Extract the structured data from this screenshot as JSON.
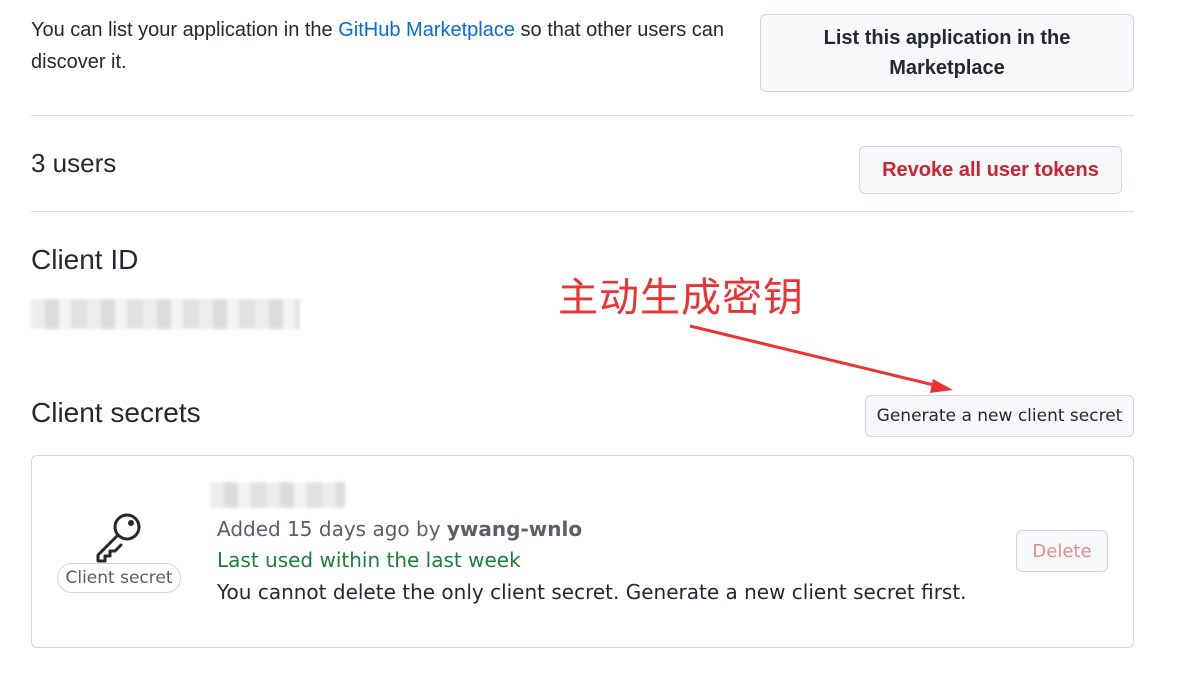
{
  "marketplace": {
    "text_before": "You can list your application in the ",
    "link_text": "GitHub Marketplace",
    "text_after": " so that other users can discover it.",
    "button_label": "List this application in the Marketplace"
  },
  "users": {
    "title": "3 users",
    "revoke_button_label": "Revoke all user tokens"
  },
  "client_id": {
    "title": "Client ID"
  },
  "annotation": {
    "text": "主动生成密钥",
    "color": "#ec3232"
  },
  "client_secrets": {
    "title": "Client secrets",
    "generate_button_label": "Generate a new client secret",
    "secret": {
      "icon": "key-icon",
      "badge_label": "Client secret",
      "added_prefix": "Added 15 days ago by ",
      "added_by": "ywang-wnlo",
      "last_used": "Last used within the last week",
      "warning": "You cannot delete the only client secret. Generate a new client secret first.",
      "delete_button_label": "Delete"
    }
  },
  "colors": {
    "link": "#0969da",
    "danger": "#cf222e",
    "success": "#1a7f37",
    "border": "#d0d7de"
  }
}
